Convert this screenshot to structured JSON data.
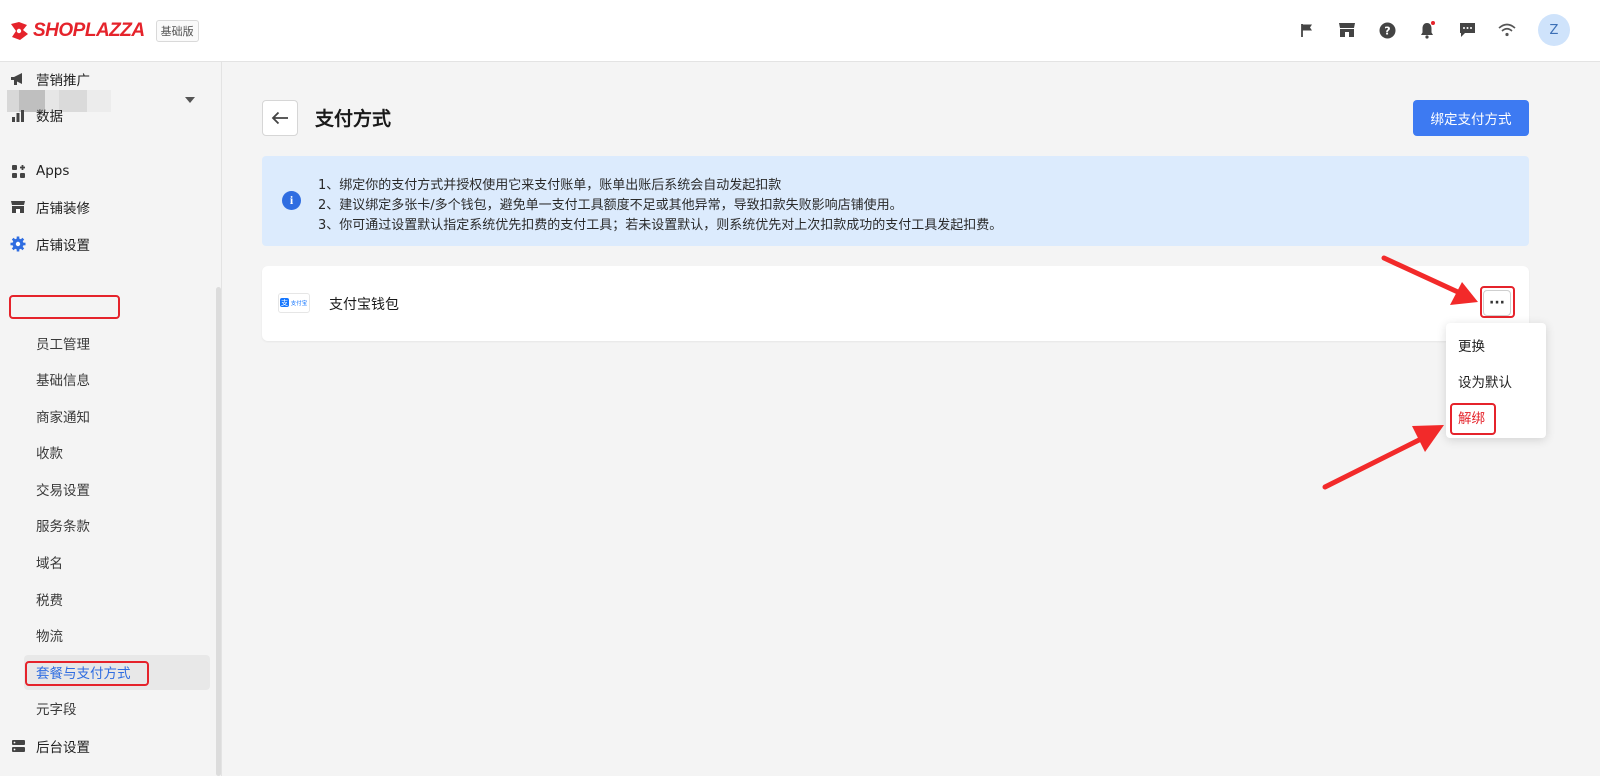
{
  "header": {
    "logo_text": "SHOPLAZZA",
    "edition_badge": "基础版",
    "icons": [
      "flag-icon",
      "store-icon",
      "help-icon",
      "bell-icon",
      "message-icon",
      "wifi-icon"
    ],
    "avatar_initial": "Z"
  },
  "sidebar": {
    "nav_top": [
      {
        "label": "营销推广",
        "icon": "megaphone-icon"
      },
      {
        "label": "数据",
        "icon": "bar-chart-icon"
      },
      {
        "label": "Apps",
        "icon": "apps-icon"
      },
      {
        "label": "店铺装修",
        "icon": "store-icon"
      },
      {
        "label": "店铺设置",
        "icon": "gear-icon"
      }
    ],
    "sub_items": [
      "员工管理",
      "基础信息",
      "商家通知",
      "收款",
      "交易设置",
      "服务条款",
      "域名",
      "税费",
      "物流",
      "套餐与支付方式",
      "元字段"
    ],
    "nav_bottom": {
      "label": "后台设置",
      "icon": "server-icon"
    },
    "active_sub": "套餐与支付方式"
  },
  "main": {
    "title": "支付方式",
    "bind_button": "绑定支付方式",
    "info_lines": [
      "1、绑定你的支付方式并授权使用它来支付账单，账单出账后系统会自动发起扣款",
      "2、建议绑定多张卡/多个钱包，避免单一支付工具额度不足或其他异常，导致扣款失败影响店铺使用。",
      "3、你可通过设置默认指定系统优先扣费的支付工具；若未设置默认，则系统优先对上次扣款成功的支付工具发起扣费。"
    ],
    "payment_method": {
      "name": "支付宝钱包",
      "logo_text": "支付宝"
    },
    "more_label": "···",
    "dropdown": [
      "更换",
      "设为默认",
      "解绑"
    ]
  },
  "colors": {
    "brand": "#e5232b",
    "primary": "#3d7af2",
    "info_bg": "#dcebfd",
    "danger": "#e5232b"
  }
}
